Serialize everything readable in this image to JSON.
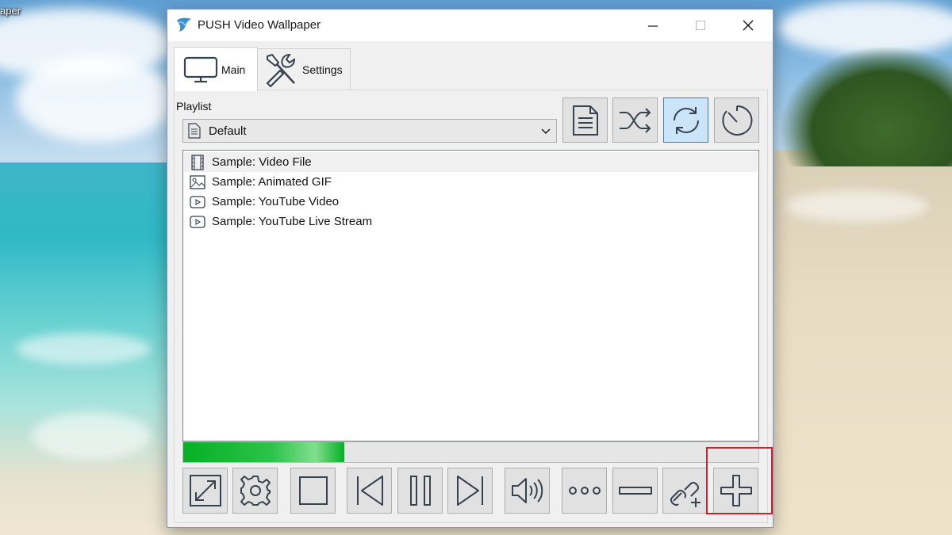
{
  "desktop": {
    "label": "aper"
  },
  "window": {
    "title": "PUSH Video Wallpaper",
    "icon": "bird-logo-icon",
    "buttons": [
      "minimize-icon",
      "maximize-icon",
      "close-icon"
    ]
  },
  "tabs": [
    {
      "label": "Main",
      "icon": "monitor-icon",
      "selected": true
    },
    {
      "label": "Settings",
      "icon": "tools-icon",
      "selected": false
    }
  ],
  "playlist": {
    "label": "Playlist",
    "selected": "Default",
    "tool_icons": [
      "document-icon",
      "shuffle-icon",
      "repeat-icon",
      "timer-icon"
    ],
    "active_tool": "repeat-icon"
  },
  "items": [
    {
      "icon": "film-icon",
      "label": "Sample: Video File",
      "selected": true
    },
    {
      "icon": "image-icon",
      "label": "Sample: Animated GIF",
      "selected": false
    },
    {
      "icon": "play-box-icon",
      "label": "Sample: YouTube Video",
      "selected": false
    },
    {
      "icon": "play-box-icon",
      "label": "Sample: YouTube Live Stream",
      "selected": false
    }
  ],
  "progress": {
    "value": 0.28,
    "color": "#06b025"
  },
  "controls": [
    "fullscreen-icon",
    "settings-gear-icon",
    "stop-icon",
    "previous-icon",
    "pause-icon",
    "next-icon",
    "volume-icon",
    "more-icon",
    "remove-icon",
    "add-url-icon",
    "add-icon"
  ],
  "colors": {
    "highlight": "#d0202a",
    "active_button": "#cce4f7"
  }
}
